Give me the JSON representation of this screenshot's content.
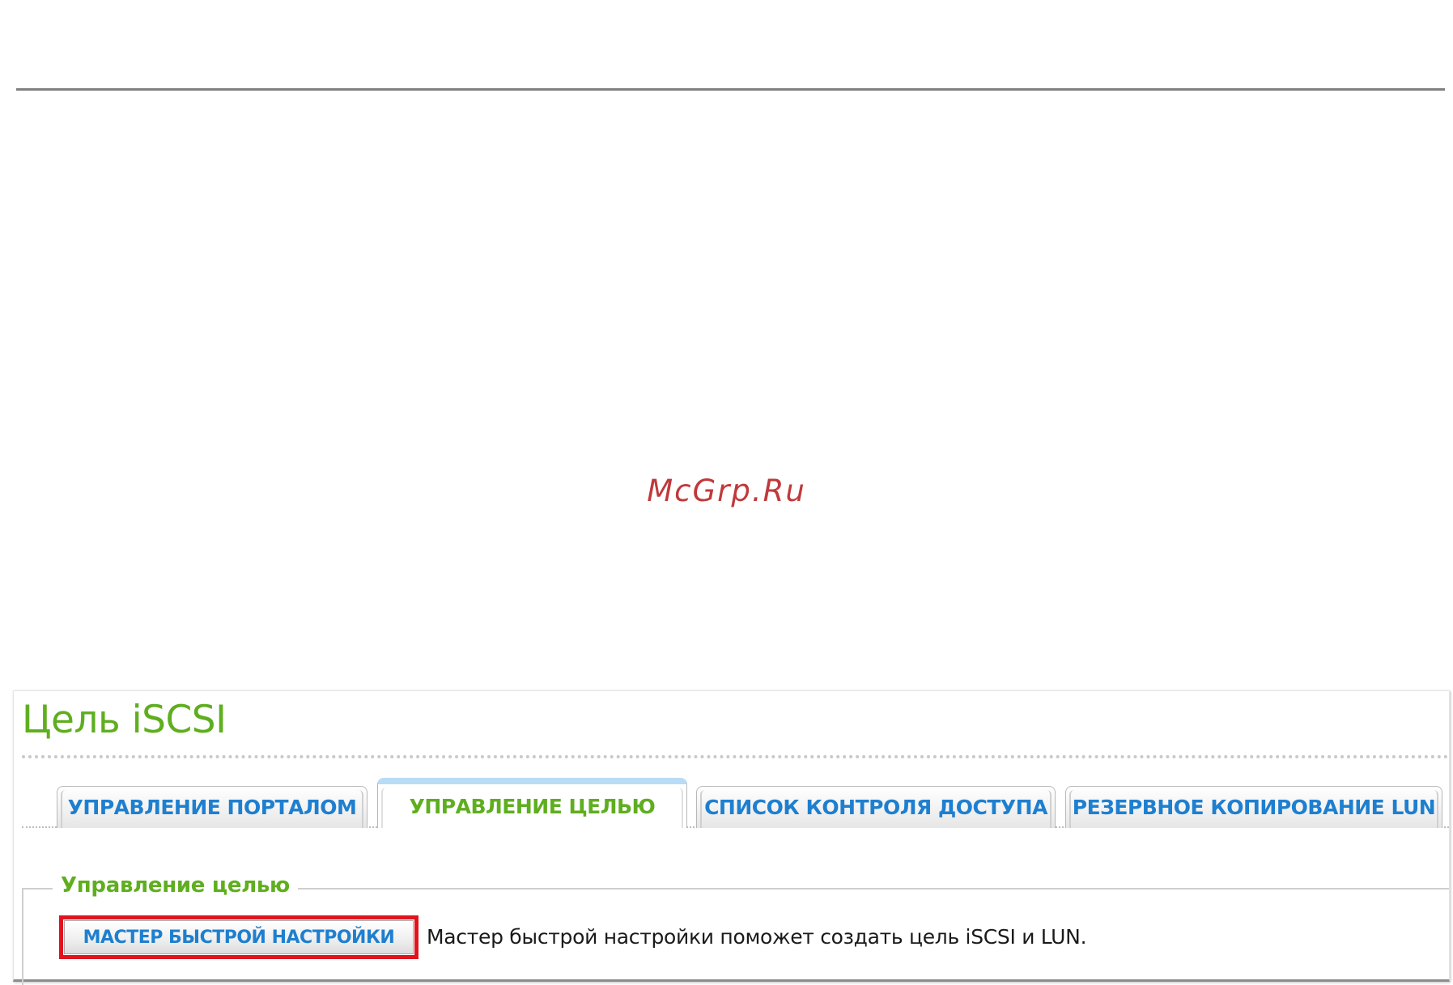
{
  "watermark": "McGrp.Ru",
  "panel": {
    "title": "Цель iSCSI"
  },
  "tabs": [
    {
      "label": "УПРАВЛЕНИЕ ПОРТАЛОМ",
      "active": false
    },
    {
      "label": "УПРАВЛЕНИЕ ЦЕЛЬЮ",
      "active": true
    },
    {
      "label": "СПИСОК КОНТРОЛЯ ДОСТУПА",
      "active": false
    },
    {
      "label": "РЕЗЕРВНОЕ КОПИРОВАНИЕ LUN",
      "active": false
    }
  ],
  "section": {
    "legend": "Управление целью",
    "wizard_button_label": "МАСТЕР БЫСТРОЙ НАСТРОЙКИ",
    "wizard_description": "Мастер быстрой настройки поможет создать цель iSCSI и LUN."
  },
  "colors": {
    "accent_green": "#5fae1f",
    "tab_blue": "#1e7fcf",
    "highlight_red": "#e0141e",
    "watermark_red": "#c0393b"
  }
}
